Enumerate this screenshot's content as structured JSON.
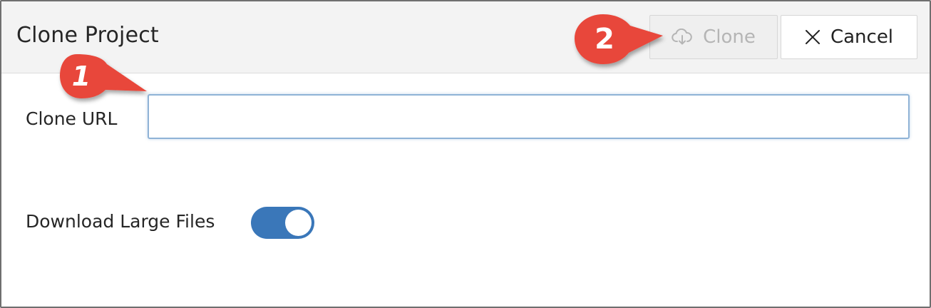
{
  "dialog": {
    "title": "Clone Project",
    "clone_button": {
      "label": "Clone",
      "icon": "cloud-download-icon",
      "enabled": false
    },
    "cancel_button": {
      "label": "Cancel",
      "icon": "close-icon"
    },
    "clone_url": {
      "label": "Clone URL",
      "value": "",
      "placeholder": ""
    },
    "download_large_files": {
      "label": "Download Large Files",
      "enabled": true
    }
  },
  "annotations": [
    {
      "number": "1",
      "target": "clone-url-input"
    },
    {
      "number": "2",
      "target": "clone-button"
    }
  ],
  "colors": {
    "accent": "#3a77b9",
    "callout": "#e8473a",
    "header_bg": "#f3f3f3"
  }
}
